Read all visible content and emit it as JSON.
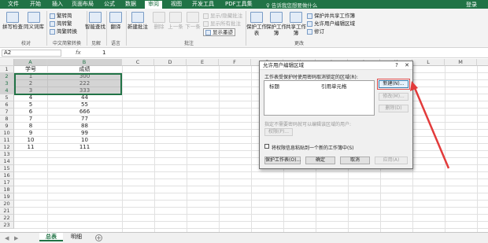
{
  "ribbon_tabs": [
    "文件",
    "开始",
    "插入",
    "页面布局",
    "公式",
    "数据",
    "审阅",
    "视图",
    "开发工具",
    "PDF工具集"
  ],
  "active_tab": "审阅",
  "tell_me": "告诉我您想要做什么",
  "login": "登录",
  "ribbon": {
    "spell_check": "拼写检查",
    "thesaurus": "同义词库",
    "group_proofing": "校对",
    "trad_to_simp": "繁转简",
    "simp_to_trad": "简转繁",
    "convert": "简繁转换",
    "group_chinese": "中文简繁转换",
    "smart_lookup": "智能查找",
    "group_insights": "见解",
    "translate": "翻译",
    "group_language": "语言",
    "new_comment": "新建批注",
    "delete": "删除",
    "previous": "上一条",
    "next": "下一条",
    "show_hide_comment": "显示/隐藏批注",
    "show_all_comments": "显示所有批注",
    "show_ink": "显示墨迹",
    "group_comments": "批注",
    "protect_sheet": "保护工作表",
    "protect_workbook": "保护工作簿",
    "share_workbook": "共享工作簿",
    "protect_share": "保护并共享工作簿",
    "allow_edit_ranges": "允许用户编辑区域",
    "track_changes": "修订",
    "group_changes": "更改"
  },
  "formula_bar": {
    "name_box": "A2",
    "fx": "fx",
    "value": "1"
  },
  "columns": [
    "A",
    "B",
    "C",
    "D",
    "E",
    "F",
    "G",
    "H",
    "I",
    "J",
    "K",
    "L",
    "M",
    "N"
  ],
  "rows": [
    "1",
    "2",
    "3",
    "4",
    "5",
    "6",
    "7",
    "8",
    "9",
    "10",
    "11",
    "12",
    "13",
    "14",
    "15",
    "16",
    "17",
    "18",
    "19",
    "20",
    "21",
    "22",
    "23"
  ],
  "table": {
    "header": [
      "学号",
      "成绩"
    ],
    "data": [
      [
        "1",
        "300"
      ],
      [
        "2",
        "222"
      ],
      [
        "3",
        "333"
      ],
      [
        "4",
        "44"
      ],
      [
        "5",
        "55"
      ],
      [
        "6",
        "666"
      ],
      [
        "7",
        "77"
      ],
      [
        "8",
        "88"
      ],
      [
        "9",
        "99"
      ],
      [
        "10",
        "10"
      ],
      [
        "11",
        "111"
      ]
    ]
  },
  "sheets": [
    "总表",
    "明细"
  ],
  "active_sheet": "总表",
  "dialog": {
    "title": "允许用户编辑区域",
    "help": "?",
    "close": "✕",
    "list_label": "工作表受保护时使用密码取消锁定的区域(R):",
    "col_title": "标题",
    "col_ref": "引用单元格",
    "btn_new": "新建(N)...",
    "btn_modify": "修改(M)...",
    "btn_delete": "删除(D)",
    "perm_label": "指定不需要密码就可以编辑该区域的用户:",
    "btn_perm": "权限(P)...",
    "paste_label": "将权限信息粘贴到一个新的工作簿中(S)",
    "btn_protect": "保护工作表(O)...",
    "btn_ok": "确定",
    "btn_cancel": "取消",
    "btn_apply": "应用(A)"
  },
  "colors": {
    "accent": "#217346",
    "arrow": "#e23b3b"
  }
}
